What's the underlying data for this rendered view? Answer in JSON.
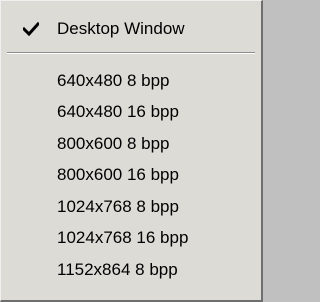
{
  "menu": {
    "checked_item": {
      "label": "Desktop Window",
      "checked": true,
      "icon": "checkmark-icon"
    },
    "items": [
      {
        "label": "640x480 8 bpp"
      },
      {
        "label": "640x480 16 bpp"
      },
      {
        "label": "800x600 8 bpp"
      },
      {
        "label": "800x600 16 bpp"
      },
      {
        "label": "1024x768 8 bpp"
      },
      {
        "label": "1024x768 16 bpp"
      },
      {
        "label": "1152x864 8 bpp"
      }
    ]
  }
}
